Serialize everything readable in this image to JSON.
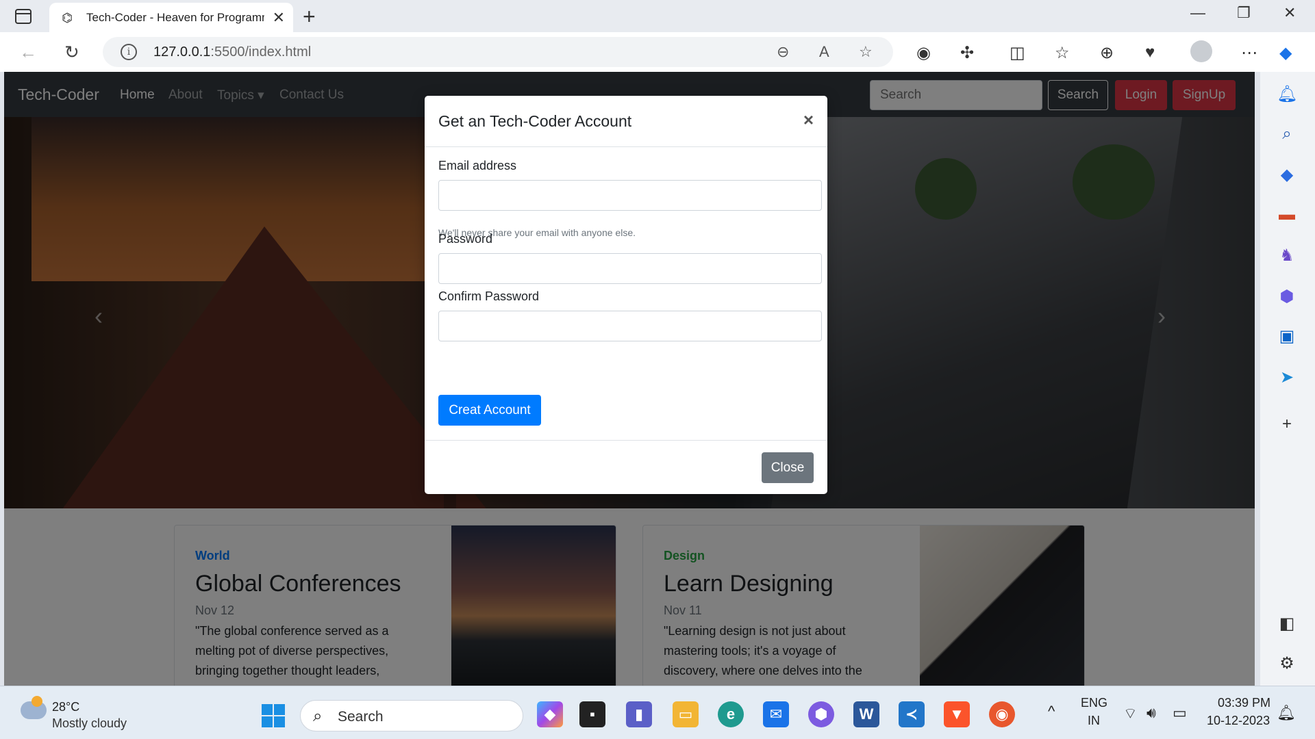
{
  "browser": {
    "tab_title": "Tech-Coder - Heaven for Programmers",
    "url_host": "127.0.0.1",
    "url_path": ":5500/index.html"
  },
  "site": {
    "brand": "Tech-Coder",
    "nav": [
      "Home",
      "About",
      "Topics",
      "Contact Us"
    ],
    "search_placeholder": "Search",
    "search_button": "Search",
    "login_button": "Login",
    "signup_button": "SignUp"
  },
  "modal": {
    "title": "Get an Tech-Coder Account",
    "close_x": "×",
    "email_label": "Email address",
    "email_help": "We'll never share your email with anyone else.",
    "password_label": "Password",
    "confirm_label": "Confirm Password",
    "submit_button": "Creat Account",
    "close_button": "Close"
  },
  "cards": [
    {
      "category": "World",
      "category_color": "#007bff",
      "heading": "Global Conferences",
      "date": "Nov 12",
      "text": "\"The global conference served as a melting pot of diverse perspectives, bringing together thought leaders,"
    },
    {
      "category": "Design",
      "category_color": "#28a745",
      "heading": "Learn Designing",
      "date": "Nov 11",
      "text": "\"Learning design is not just about mastering tools; it's a voyage of discovery, where one delves into the"
    }
  ],
  "taskbar": {
    "temperature": "28°C",
    "condition": "Mostly cloudy",
    "search_label": "Search",
    "lang_top": "ENG",
    "lang_bottom": "IN",
    "time": "03:39 PM",
    "date": "10-12-2023"
  }
}
